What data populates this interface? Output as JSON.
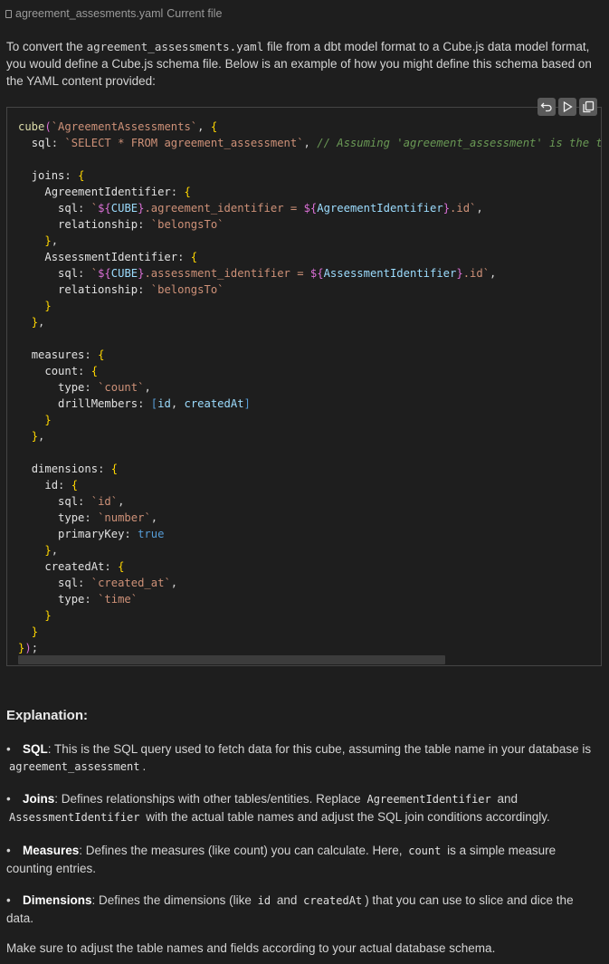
{
  "file_header": {
    "filename": "agreement_assesments.yaml",
    "status": "Current file"
  },
  "intro": {
    "before": "To convert the ",
    "code": "agreement_assessments.yaml",
    "after": " file from a dbt model format to a Cube.js data model format, you would define a Cube.js schema file. Below is an example of how you might define this schema based on the YAML content provided:"
  },
  "code_tools": {
    "insert_icon": "undo-arrow-icon",
    "run_icon": "play-icon",
    "copy_icon": "copy-icon"
  },
  "code_lines": [
    "cube(`AgreementAssessments`, {",
    "  sql: `SELECT * FROM agreement_assessment`, // Assuming 'agreement_assessment' is the t",
    "",
    "  joins: {",
    "    AgreementIdentifier: {",
    "      sql: `${CUBE}.agreement_identifier = ${AgreementIdentifier}.id`,",
    "      relationship: `belongsTo`",
    "    },",
    "    AssessmentIdentifier: {",
    "      sql: `${CUBE}.assessment_identifier = ${AssessmentIdentifier}.id`,",
    "      relationship: `belongsTo`",
    "    }",
    "  },",
    "",
    "  measures: {",
    "    count: {",
    "      type: `count`,",
    "      drillMembers: [id, createdAt]",
    "    }",
    "  },",
    "",
    "  dimensions: {",
    "    id: {",
    "      sql: `id`,",
    "      type: `number`,",
    "      primaryKey: true",
    "    },",
    "    createdAt: {",
    "      sql: `created_at`,",
    "      type: `time`",
    "    }",
    "  }",
    "});"
  ],
  "explanation": {
    "title": "Explanation:",
    "bullet_symbol": "•",
    "sql": {
      "label": "SQL",
      "text": ": This is the SQL query used to fetch data for this cube, assuming the table name in your database is",
      "code": "agreement_assessment",
      "end": "."
    },
    "joins": {
      "label": "Joins",
      "text": ": Defines relationships with other tables/entities. Replace",
      "code1": "AgreementIdentifier",
      "mid": "and",
      "code2": "AssessmentIdentifier",
      "end": "with the actual table names and adjust the SQL join conditions accordingly."
    },
    "measures": {
      "label": "Measures",
      "text": ": Defines the measures (like count) you can calculate. Here,",
      "code": "count",
      "end": "is a simple measure counting entries."
    },
    "dimensions": {
      "label": "Dimensions",
      "text": ": Defines the dimensions (like",
      "code1": "id",
      "mid": "and",
      "code2": "createdAt",
      "end": ") that you can use to slice and dice the data."
    },
    "footer": "Make sure to adjust the table names and fields according to your actual database schema."
  }
}
